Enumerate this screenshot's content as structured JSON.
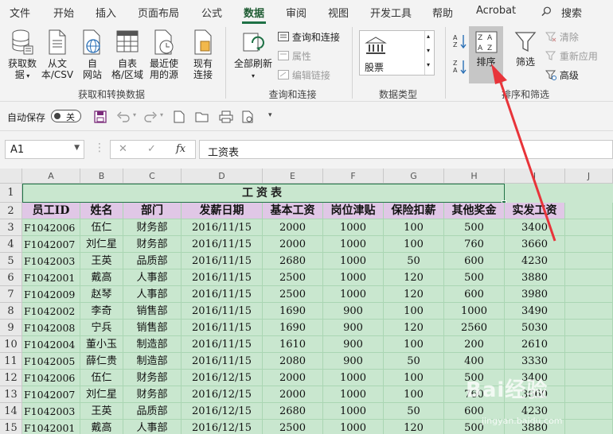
{
  "menu": {
    "tabs": [
      "文件",
      "开始",
      "插入",
      "页面布局",
      "公式",
      "数据",
      "审阅",
      "视图",
      "开发工具",
      "帮助",
      "Acrobat"
    ],
    "active_tab": "数据",
    "search_label": "搜索"
  },
  "ribbon": {
    "get_data": {
      "line1": "获取数",
      "line2": "据"
    },
    "from_text": {
      "line1": "从文",
      "line2": "本/CSV"
    },
    "from_web": {
      "line1": "自",
      "line2": "网站"
    },
    "from_table": {
      "line1": "自表",
      "line2": "格/区域"
    },
    "recent_sources": {
      "line1": "最近使",
      "line2": "用的源"
    },
    "existing_conn": {
      "line1": "现有",
      "line2": "连接"
    },
    "group_get_transform": "获取和转换数据",
    "refresh_all": {
      "line1": "全部刷新"
    },
    "queries_connections": "查询和连接",
    "properties": "属性",
    "edit_links": "编辑链接",
    "group_queries": "查询和连接",
    "stock_label": "股票",
    "group_data_types": "数据类型",
    "sort_label": "排序",
    "filter_label": "筛选",
    "clear_label": "清除",
    "reapply_label": "重新应用",
    "advanced_label": "高级",
    "group_sort_filter": "排序和筛选"
  },
  "qat": {
    "autosave_label": "自动保存",
    "toggle_text": "关"
  },
  "formula_bar": {
    "name_box": "A1",
    "fx": "fx",
    "formula": "工资表"
  },
  "grid": {
    "columns": [
      "A",
      "B",
      "C",
      "D",
      "E",
      "F",
      "G",
      "H",
      "I",
      "J"
    ],
    "row_numbers": [
      "1",
      "2",
      "3",
      "4",
      "5",
      "6",
      "7",
      "8",
      "9",
      "10",
      "11",
      "12",
      "13",
      "14",
      "15"
    ],
    "title": "工资表",
    "headers": [
      "员工ID",
      "姓名",
      "部门",
      "发薪日期",
      "基本工资",
      "岗位津贴",
      "保险扣薪",
      "其他奖金",
      "实发工资"
    ],
    "rows": [
      [
        "F1042006",
        "伍仁",
        "财务部",
        "2016/11/15",
        "2000",
        "1000",
        "100",
        "500",
        "3400"
      ],
      [
        "F1042007",
        "刘仁星",
        "财务部",
        "2016/11/15",
        "2000",
        "1000",
        "100",
        "760",
        "3660"
      ],
      [
        "F1042003",
        "王英",
        "品质部",
        "2016/11/15",
        "2680",
        "1000",
        "50",
        "600",
        "4230"
      ],
      [
        "F1042001",
        "戴高",
        "人事部",
        "2016/11/15",
        "2500",
        "1000",
        "120",
        "500",
        "3880"
      ],
      [
        "F1042009",
        "赵琴",
        "人事部",
        "2016/11/15",
        "2500",
        "1000",
        "120",
        "600",
        "3980"
      ],
      [
        "F1042002",
        "李奇",
        "销售部",
        "2016/11/15",
        "1690",
        "900",
        "100",
        "1000",
        "3490"
      ],
      [
        "F1042008",
        "宁兵",
        "销售部",
        "2016/11/15",
        "1690",
        "900",
        "120",
        "2560",
        "5030"
      ],
      [
        "F1042004",
        "董小玉",
        "制造部",
        "2016/11/15",
        "1610",
        "900",
        "100",
        "200",
        "2610"
      ],
      [
        "F1042005",
        "薛仁贵",
        "制造部",
        "2016/11/15",
        "2080",
        "900",
        "50",
        "400",
        "3330"
      ],
      [
        "F1042006",
        "伍仁",
        "财务部",
        "2016/12/15",
        "2000",
        "1000",
        "100",
        "500",
        "3400"
      ],
      [
        "F1042007",
        "刘仁星",
        "财务部",
        "2016/12/15",
        "2000",
        "1000",
        "100",
        "760",
        "3660"
      ],
      [
        "F1042003",
        "王英",
        "品质部",
        "2016/12/15",
        "2680",
        "1000",
        "50",
        "600",
        "4230"
      ],
      [
        "F1042001",
        "戴高",
        "人事部",
        "2016/12/15",
        "2500",
        "1000",
        "120",
        "500",
        "3880"
      ]
    ]
  },
  "watermark": {
    "brand": "Bai经验",
    "sub": "jingyan.baidu.com"
  },
  "colors": {
    "accent": "#1e7145",
    "cell_bg": "#c9e7cf",
    "header_bg": "#e0c7e6",
    "arrow": "#e8343a"
  }
}
